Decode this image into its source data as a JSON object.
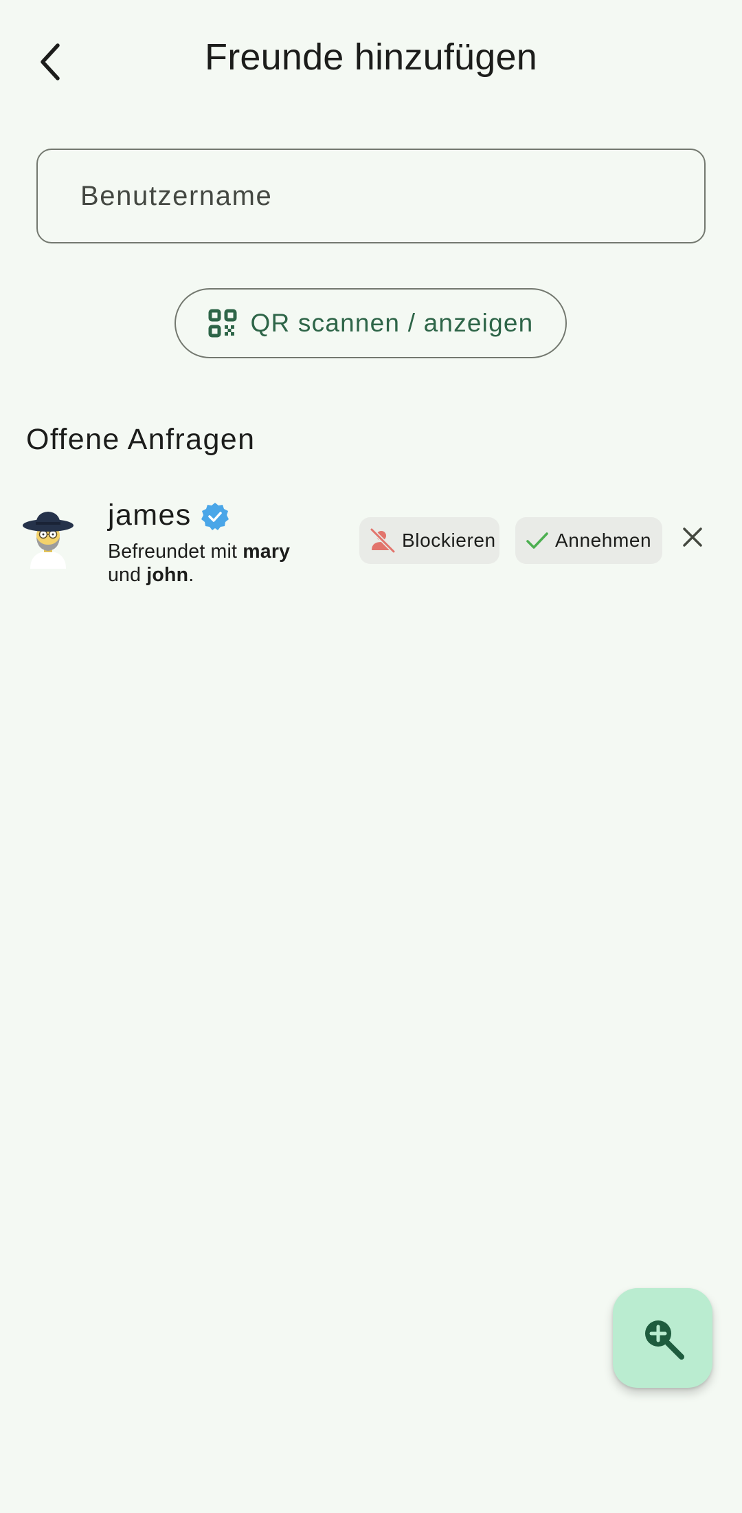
{
  "header": {
    "title": "Freunde hinzufügen",
    "back_icon": "arrow-back-icon"
  },
  "search": {
    "placeholder": "Benutzername",
    "value": ""
  },
  "qr_button": {
    "label": "QR scannen / anzeigen",
    "icon": "qr-code-icon"
  },
  "pending": {
    "title": "Offene Anfragen",
    "requests": [
      {
        "username": "james",
        "verified": true,
        "mutual_prefix": "Befreundet mit ",
        "mutual_friend_1": "mary",
        "mutual_joiner": "und ",
        "mutual_friend_2": "john",
        "mutual_suffix": ".",
        "block_label": "Blockieren",
        "accept_label": "Annehmen",
        "dismiss_icon": "close-icon"
      }
    ]
  },
  "fab": {
    "icon": "zoom-in-icon"
  },
  "colors": {
    "background": "#f4f9f3",
    "primary_green": "#2e6548",
    "fab_container": "#baecd0",
    "chip_bg": "#e9ebe7",
    "block_red": "#e2746c",
    "accept_green": "#4caf50",
    "verified_blue": "#4aa6e8"
  }
}
